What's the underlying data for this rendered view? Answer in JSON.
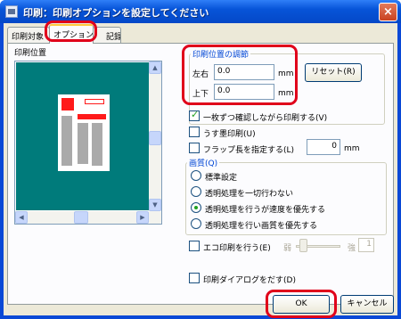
{
  "window": {
    "title": "印刷：印刷オプションを設定してください",
    "close": "×"
  },
  "tabs": [
    {
      "label": "印刷対象"
    },
    {
      "label": "オプション"
    },
    {
      "label": "記録"
    }
  ],
  "preview": {
    "label": "印刷位置"
  },
  "position_group": {
    "title": "印刷位置の調節",
    "horizontal_label": "左右",
    "horizontal_value": "0.0",
    "horizontal_unit": "mm",
    "vertical_label": "上下",
    "vertical_value": "0.0",
    "vertical_unit": "mm",
    "reset_label": "リセット(R)"
  },
  "options": {
    "confirm_each": "一枚ずつ確認しながら印刷する(V)",
    "confirm_each_checked": true,
    "light_print": "うす墨印刷(U)",
    "light_print_checked": false,
    "flap_length": "フラップ長を指定する(L)",
    "flap_length_checked": false,
    "flap_value": "0",
    "flap_unit": "mm"
  },
  "quality_group": {
    "title": "画質(Q)",
    "options": [
      "標準設定",
      "透明処理を一切行わない",
      "透明処理を行うが速度を優先する",
      "透明処理を行い画質を優先する"
    ],
    "selected_index": 2
  },
  "eco": {
    "label": "エコ印刷を行う(E)",
    "checked": false,
    "weak": "弱",
    "strong": "強",
    "level": "1"
  },
  "print_dialog": {
    "label": "印刷ダイアログをだす(D)",
    "checked": false
  },
  "footer": {
    "ok_label": "OK",
    "cancel_label": "キャンセル"
  },
  "colors": {
    "accent_red": "#e0001a",
    "preview_bg": "#007b7b",
    "group_title": "#0046d5"
  }
}
